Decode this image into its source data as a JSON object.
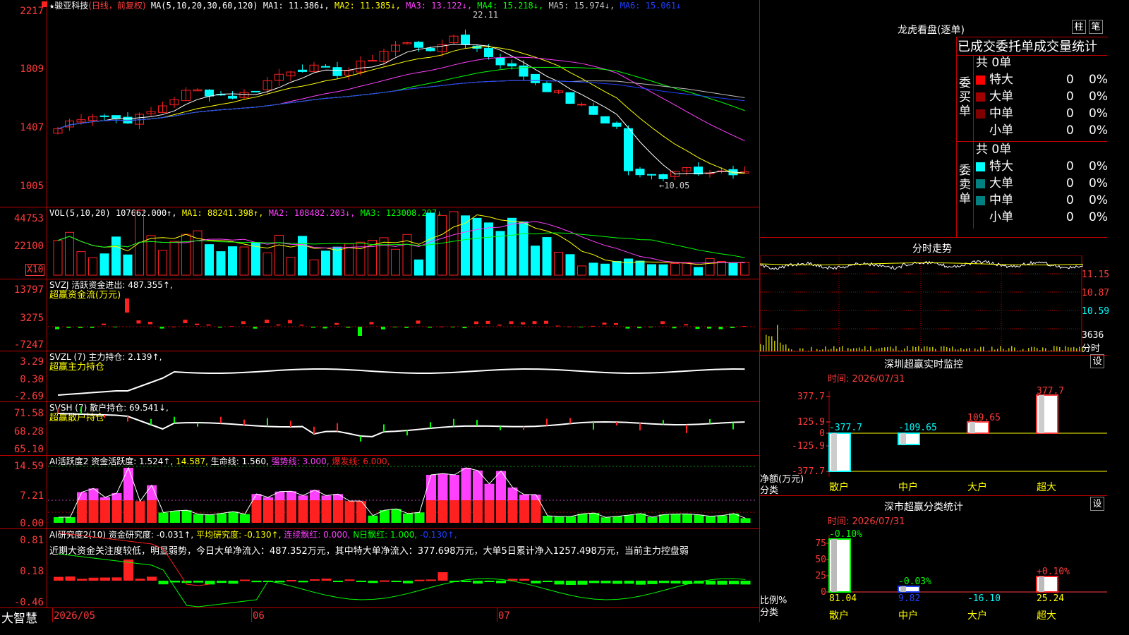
{
  "app": {
    "brand": "大智慧",
    "date_axis": {
      "start": "2026/05",
      "m1": "06",
      "m2": "07"
    }
  },
  "colors": {
    "up": "#ff2020",
    "down": "#00ffff",
    "grid": "#c00000",
    "ma1": "#ffffff",
    "ma2": "#ffff00",
    "ma3": "#ff40ff",
    "ma4": "#00ff00",
    "ma5": "#c0c0c0",
    "ma6": "#2040ff"
  },
  "main": {
    "title_star": "★",
    "stock": "骏亚科技",
    "mode": "(日线，前复权)",
    "ma_head": "MA(5,10,20,30,60,120)",
    "ma1": "MA1: 11.386↓,",
    "ma2": "MA2: 11.385↓,",
    "ma3": "MA3: 13.122↓,",
    "ma4": "MA4: 15.218↓,",
    "ma5": "MA5: 15.974↓,",
    "ma6": "MA6: 15.061↓",
    "yticks": [
      "2217",
      "1809",
      "1407",
      "1005"
    ],
    "high_label": "22.11",
    "low_label": "←10.05"
  },
  "vol": {
    "head": "VOL(5,10,20)",
    "v": "107662.000↑,",
    "ma1": "MA1: 88241.398↑,",
    "ma2": "MA2: 108482.203↓,",
    "ma3": "MA3: 123008.297↓",
    "yticks": [
      "44753",
      "22100"
    ],
    "unit": "X10"
  },
  "svzj": {
    "head": "SVZJ  活跃资金进出: 487.355↑,",
    "sub": "超赢资金流(万元)",
    "yticks": [
      "13797",
      "3275",
      "-7247"
    ]
  },
  "svzl": {
    "head": "SVZL (7) 主力持仓: 2.139↑,",
    "sub": "超赢主力持仓",
    "yticks": [
      "3.29",
      "0.30",
      "-2.69"
    ]
  },
  "svsh": {
    "head": "SVSH (7) 散户持仓: 69.541↓,",
    "sub": "超赢散户持仓",
    "yticks": [
      "71.58",
      "68.28",
      "65.10"
    ]
  },
  "ai1": {
    "head": "AI活跃度2 资金活跃度: 1.524↑,",
    "v2": "14.587,",
    "life": "生命线: 1.560,",
    "strong": "强势线: 3.000,",
    "burst": "爆发线: 6.000,",
    "yticks": [
      "14.59",
      "7.21",
      "0.00"
    ]
  },
  "ai2": {
    "head": "AI研究度2(10) 资金研究度: -0.031↑,",
    "avg": "平均研究度: -0.130↑,",
    "lianxu": "连续飘红: 0.000,",
    "nri": "N日飘红: 1.000,",
    "neg": "-0.130↑,",
    "desc": "近期大资金关注度较低，明显弱势，今日大单净流入：487.352万元，其中特大单净流入：377.698万元，大单5日累计净入1257.498万元，当前主力控盘弱",
    "yticks": [
      "0.81",
      "0.18",
      "-0.46"
    ]
  },
  "longhu": {
    "title": "龙虎看盘(逐单)",
    "btn1": "柱",
    "btn2": "笔",
    "subtitle": "已成交委托单成交量统计",
    "buy": {
      "label": "委买单",
      "total": "共 0单",
      "rows": [
        {
          "name": "特大",
          "count": "0",
          "pct": "0%",
          "color": "#ff0000"
        },
        {
          "name": "大单",
          "count": "0",
          "pct": "0%",
          "color": "#a00000"
        },
        {
          "name": "中单",
          "count": "0",
          "pct": "0%",
          "color": "#800000"
        },
        {
          "name": "小单",
          "count": "0",
          "pct": "0%",
          "color": "#000000"
        }
      ]
    },
    "sell": {
      "label": "委卖单",
      "total": "共 0单",
      "rows": [
        {
          "name": "特大",
          "count": "0",
          "pct": "0%",
          "color": "#00ffff"
        },
        {
          "name": "大单",
          "count": "0",
          "pct": "0%",
          "color": "#008080"
        },
        {
          "name": "中单",
          "count": "0",
          "pct": "0%",
          "color": "#008080"
        },
        {
          "name": "小单",
          "count": "0",
          "pct": "0%",
          "color": "#000000"
        }
      ]
    }
  },
  "fenshi": {
    "title": "分时走势",
    "yticks": [
      "11.15",
      "10.87",
      "10.59",
      "3636",
      "分时"
    ]
  },
  "monitor": {
    "title": "深圳超赢实时监控",
    "btn": "设",
    "time": "时间: 2026/07/31",
    "yticks": [
      "377.7",
      "125.9",
      "0",
      "-125.9",
      "-377.7"
    ],
    "ylabel1": "净额(万元)",
    "ylabel2": "分类",
    "cats": [
      "散户",
      "中户",
      "大户",
      "超大"
    ],
    "values_label": [
      "-377.7",
      "-109.65",
      "109.65",
      "377.7"
    ]
  },
  "stats": {
    "title": "深市超赢分类统计",
    "btn": "设",
    "time": "时间: 2026/07/31",
    "yticks": [
      "75",
      "50",
      "25",
      "0"
    ],
    "ylabel1": "比例%",
    "ylabel2": "分类",
    "cats": [
      "散户",
      "中户",
      "大户",
      "超大"
    ],
    "top_labels": [
      "-0.10%",
      "-0.03%",
      "",
      "+0.10%"
    ],
    "bottom_labels": [
      "81.04",
      "9.82",
      "-16.10",
      "25.24"
    ]
  }
}
